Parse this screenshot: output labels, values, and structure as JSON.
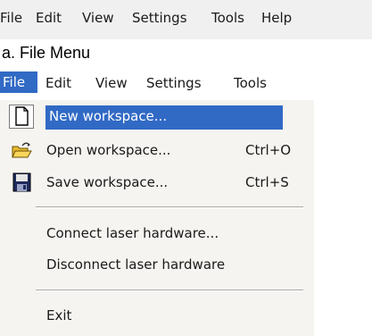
{
  "top_menubar": {
    "items": [
      "File",
      "Edit",
      "View",
      "Settings",
      "Tools",
      "Help"
    ]
  },
  "caption": "a. File Menu",
  "menubar": {
    "items": [
      "File",
      "Edit",
      "View",
      "Settings",
      "Tools"
    ],
    "active": "File"
  },
  "file_menu": {
    "items": [
      {
        "label": "New workspace...",
        "shortcut": "",
        "icon": "new-document-icon"
      },
      {
        "label": "Open workspace...",
        "shortcut": "Ctrl+O",
        "icon": "open-folder-icon"
      },
      {
        "label": "Save workspace...",
        "shortcut": "Ctrl+S",
        "icon": "save-disk-icon"
      },
      {
        "label": "Connect laser hardware...",
        "shortcut": ""
      },
      {
        "label": "Disconnect laser hardware",
        "shortcut": ""
      },
      {
        "label": "Exit",
        "shortcut": ""
      }
    ]
  },
  "colors": {
    "highlight": "#316ac5",
    "menu_bg": "#f5f4f1",
    "top_bar_bg": "#f0f0f0"
  }
}
